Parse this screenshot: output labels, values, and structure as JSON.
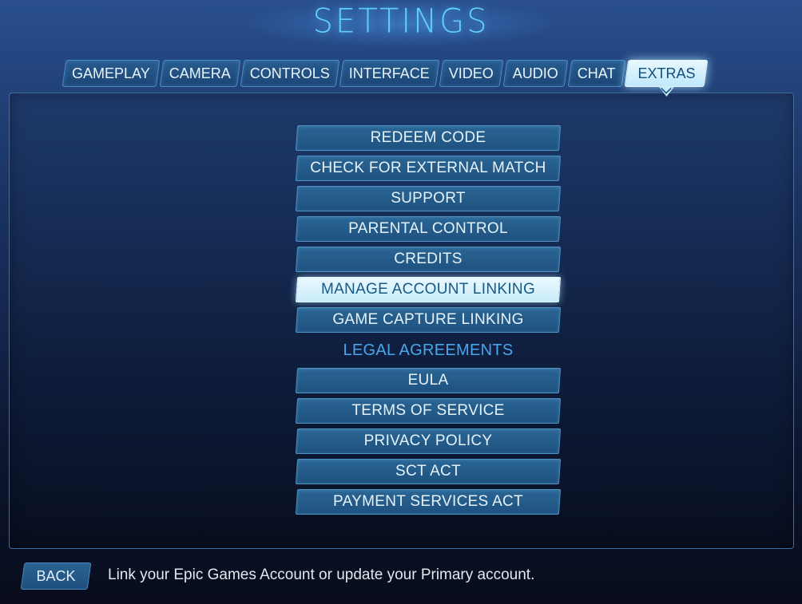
{
  "header": {
    "title": "SETTINGS"
  },
  "tabs": [
    {
      "label": "GAMEPLAY",
      "active": false
    },
    {
      "label": "CAMERA",
      "active": false
    },
    {
      "label": "CONTROLS",
      "active": false
    },
    {
      "label": "INTERFACE",
      "active": false
    },
    {
      "label": "VIDEO",
      "active": false
    },
    {
      "label": "AUDIO",
      "active": false
    },
    {
      "label": "CHAT",
      "active": false
    },
    {
      "label": "EXTRAS",
      "active": true
    }
  ],
  "menu": {
    "items": [
      {
        "label": "REDEEM CODE"
      },
      {
        "label": "CHECK FOR EXTERNAL MATCH"
      },
      {
        "label": "SUPPORT"
      },
      {
        "label": "PARENTAL CONTROL"
      },
      {
        "label": "CREDITS"
      },
      {
        "label": "MANAGE ACCOUNT LINKING",
        "selected": true
      },
      {
        "label": "GAME CAPTURE LINKING"
      }
    ],
    "section_label": "LEGAL AGREEMENTS",
    "legal_items": [
      {
        "label": "EULA"
      },
      {
        "label": "TERMS OF SERVICE"
      },
      {
        "label": "PRIVACY POLICY"
      },
      {
        "label": "SCT ACT"
      },
      {
        "label": "PAYMENT SERVICES ACT"
      }
    ]
  },
  "footer": {
    "back_label": "BACK",
    "hint": "Link your Epic Games Account or update your Primary account."
  }
}
